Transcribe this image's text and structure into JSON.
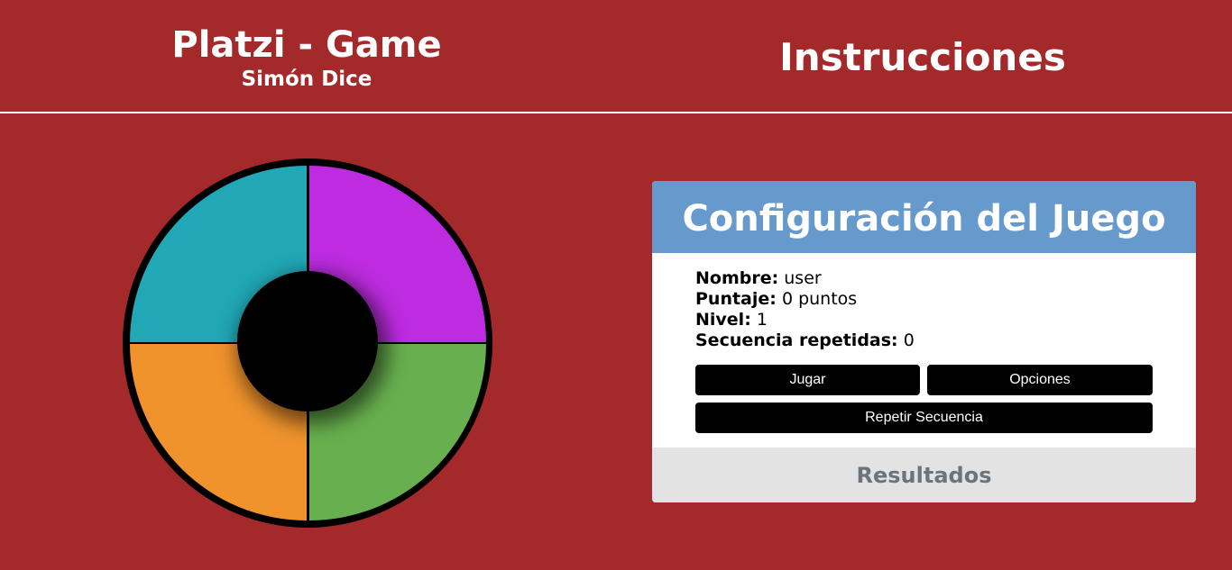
{
  "header": {
    "title": "Platzi - Game",
    "subtitle": "Simón Dice",
    "instructions_link": "Instrucciones"
  },
  "board": {
    "quadrants": [
      {
        "name": "top-left",
        "color": "#21a7b6"
      },
      {
        "name": "top-right",
        "color": "#bd2ce0"
      },
      {
        "name": "bottom-left",
        "color": "#f0932d"
      },
      {
        "name": "bottom-right",
        "color": "#68b04f"
      }
    ]
  },
  "config": {
    "title": "Configuración del Juego",
    "fields": {
      "nombre": {
        "label": "Nombre:",
        "value": "user"
      },
      "puntaje": {
        "label": "Puntaje:",
        "value": "0 puntos"
      },
      "nivel": {
        "label": "Nivel:",
        "value": "1"
      },
      "secuencia": {
        "label": "Secuencia repetidas:",
        "value": "0"
      }
    },
    "buttons": {
      "play": "Jugar",
      "options": "Opciones",
      "repeat": "Repetir Secuencia"
    },
    "results_tab": "Resultados"
  },
  "colors": {
    "background": "#a4292b",
    "panel_header": "#6699cc",
    "results_bg": "#e3e3e3"
  }
}
